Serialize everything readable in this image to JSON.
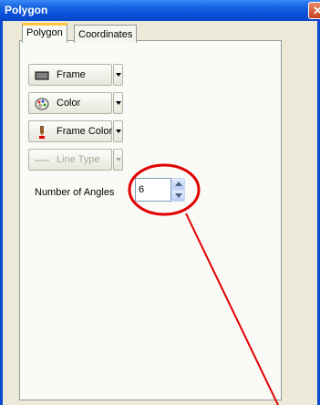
{
  "window": {
    "title": "Polygon",
    "close_glyph": "✕"
  },
  "tabs": [
    {
      "label": "Polygon",
      "active": true
    },
    {
      "label": "Coordinates",
      "active": false
    }
  ],
  "buttons": [
    {
      "label": "Frame",
      "icon": "frame-swatch-icon",
      "enabled": true
    },
    {
      "label": "Color",
      "icon": "palette-icon",
      "enabled": true
    },
    {
      "label": "Frame Color",
      "icon": "pen-icon",
      "enabled": true
    },
    {
      "label": "Line Type",
      "icon": "line-type-icon",
      "enabled": false
    }
  ],
  "angles": {
    "label": "Number of Angles",
    "value": "6"
  },
  "colors": {
    "titlebar": "#0a4ed8",
    "annotation": "#e00000",
    "active_tab_accent": "#ffc83c",
    "disabled_text": "#aca899"
  }
}
